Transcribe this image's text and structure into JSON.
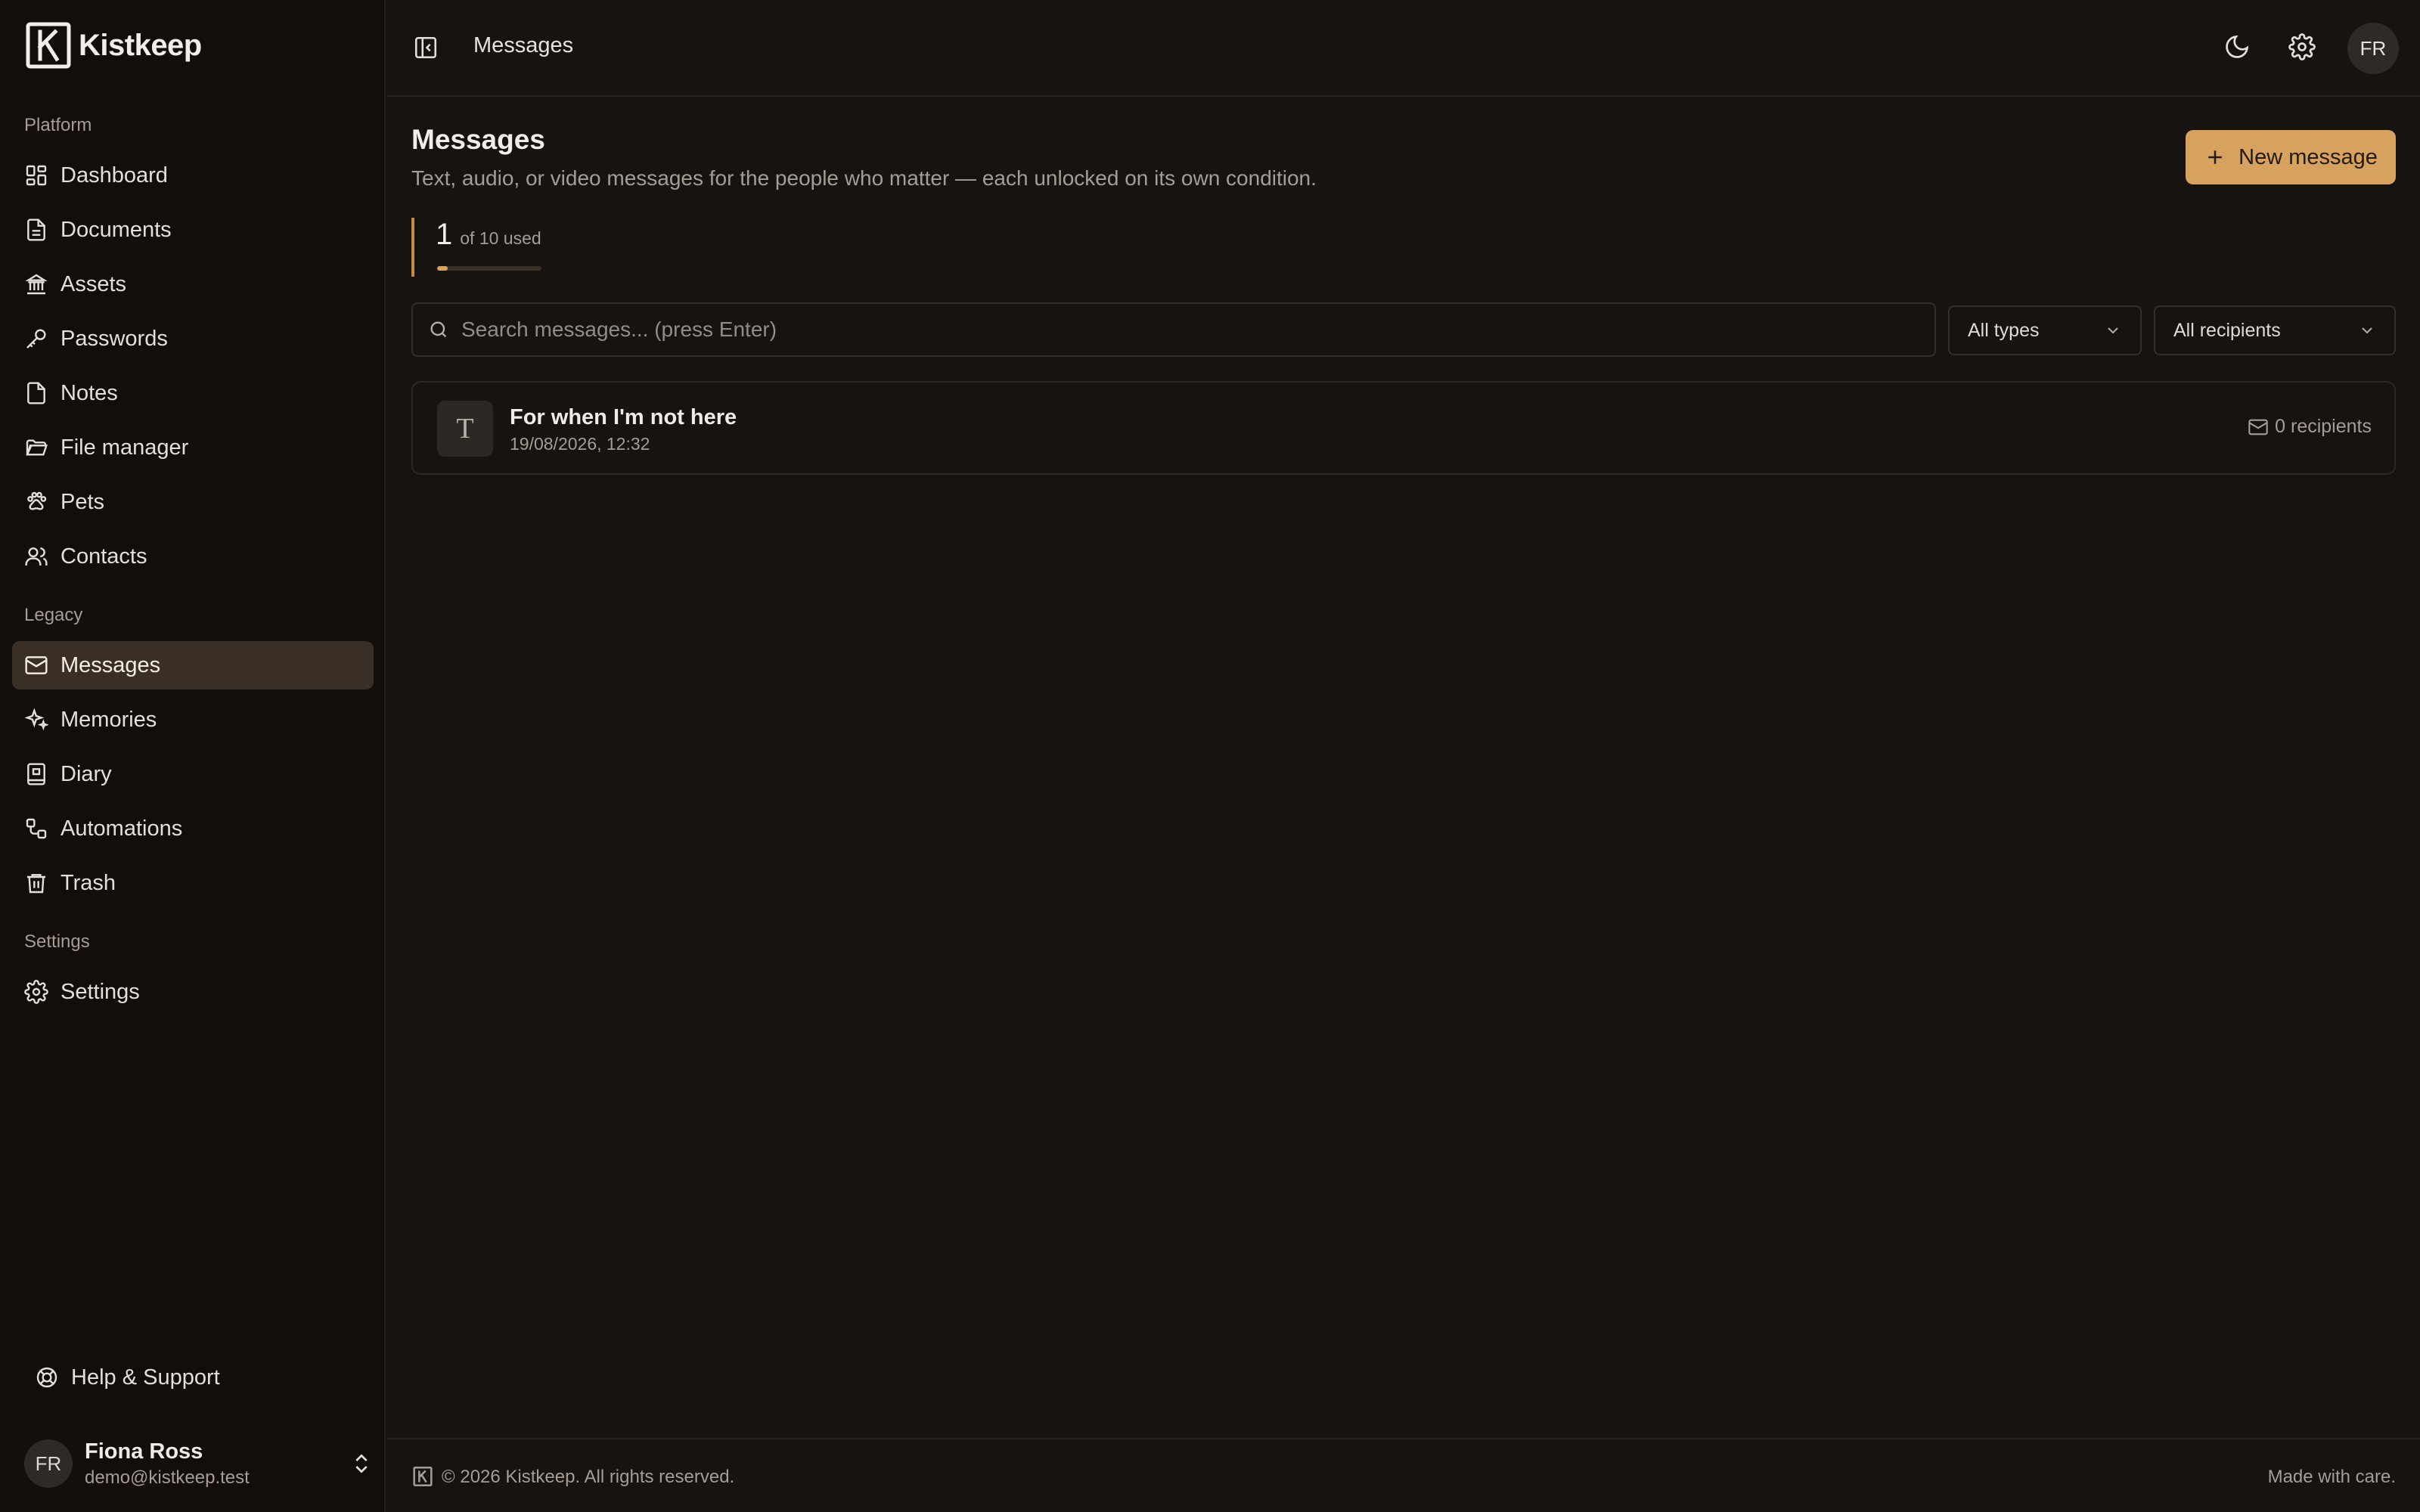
{
  "app": {
    "name": "Kistkeep"
  },
  "sidebar": {
    "sections": [
      {
        "label": "Platform",
        "items": [
          {
            "label": "Dashboard",
            "icon": "grid-icon"
          },
          {
            "label": "Documents",
            "icon": "document-icon"
          },
          {
            "label": "Assets",
            "icon": "bank-icon"
          },
          {
            "label": "Passwords",
            "icon": "key-icon"
          },
          {
            "label": "Notes",
            "icon": "note-icon"
          },
          {
            "label": "File manager",
            "icon": "folder-icon"
          },
          {
            "label": "Pets",
            "icon": "paw-icon"
          },
          {
            "label": "Contacts",
            "icon": "users-icon"
          }
        ]
      },
      {
        "label": "Legacy",
        "items": [
          {
            "label": "Messages",
            "icon": "mail-icon",
            "active": true
          },
          {
            "label": "Memories",
            "icon": "sparkles-icon"
          },
          {
            "label": "Diary",
            "icon": "book-icon"
          },
          {
            "label": "Automations",
            "icon": "workflow-icon"
          },
          {
            "label": "Trash",
            "icon": "trash-icon"
          }
        ]
      },
      {
        "label": "Settings",
        "items": [
          {
            "label": "Settings",
            "icon": "gear-icon"
          }
        ]
      }
    ],
    "help_label": "Help & Support",
    "user": {
      "initials": "FR",
      "name": "Fiona Ross",
      "email": "demo@kistkeep.test"
    }
  },
  "topbar": {
    "title": "Messages",
    "avatar_initials": "FR"
  },
  "page": {
    "title": "Messages",
    "subtitle": "Text, audio, or video messages for the people who matter — each unlocked on its own condition.",
    "new_button_label": "New message"
  },
  "usage": {
    "count": "1",
    "text": "of 10 used",
    "fraction": 0.1
  },
  "filters": {
    "search_placeholder": "Search messages... (press Enter)",
    "type_select": "All types",
    "recipient_select": "All recipients"
  },
  "messages": [
    {
      "type_letter": "T",
      "title": "For when I'm not here",
      "date": "19/08/2026, 12:32",
      "recipients": "0 recipients"
    }
  ],
  "footer": {
    "copyright": "© 2026 Kistkeep. All rights reserved.",
    "tagline": "Made with care."
  },
  "colors": {
    "accent": "#d7a25e",
    "background": "#161311",
    "sidebar": "#130d0b",
    "active_nav": "#3a2f26"
  }
}
